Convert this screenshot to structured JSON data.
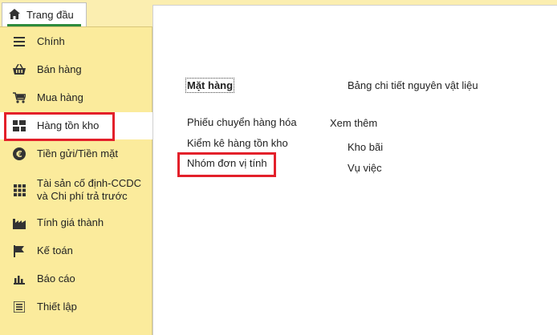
{
  "top_tab": {
    "label": "Trang đầu",
    "icon": "home-icon"
  },
  "sidebar": {
    "items": [
      {
        "label": "Chính",
        "icon": "list-icon"
      },
      {
        "label": "Bán hàng",
        "icon": "basket-icon"
      },
      {
        "label": "Mua hàng",
        "icon": "cart-icon"
      },
      {
        "label": "Hàng tồn kho",
        "icon": "inventory-icon"
      },
      {
        "label": "Tiền gửi/Tiền mặt",
        "icon": "euro-icon"
      },
      {
        "label": "Tài sản cố định-CCDC",
        "label2": "và Chi phí trả trước",
        "icon": "grid-icon"
      },
      {
        "label": "Tính giá thành",
        "icon": "factory-icon"
      },
      {
        "label": "Kế toán",
        "icon": "flag-icon"
      },
      {
        "label": "Báo cáo",
        "icon": "bar-chart-icon"
      },
      {
        "label": "Thiết lập",
        "icon": "settings-list-icon"
      }
    ],
    "active_index": 3
  },
  "main": {
    "item_header": "Mặt hàng",
    "material_detail": "Bảng chi tiết nguyên vật liệu",
    "goods_transfer": "Phiếu chuyển hàng hóa",
    "see_more": "Xem thêm",
    "inventory_check": "Kiểm kê hàng tồn kho",
    "warehouse": "Kho bãi",
    "unit_group": "Nhóm đơn vị tính",
    "case": "Vụ việc"
  },
  "colors": {
    "sidebar_bg": "#fbeb9c",
    "highlight": "#e3202a",
    "tab_accent": "#2e8b3d"
  }
}
